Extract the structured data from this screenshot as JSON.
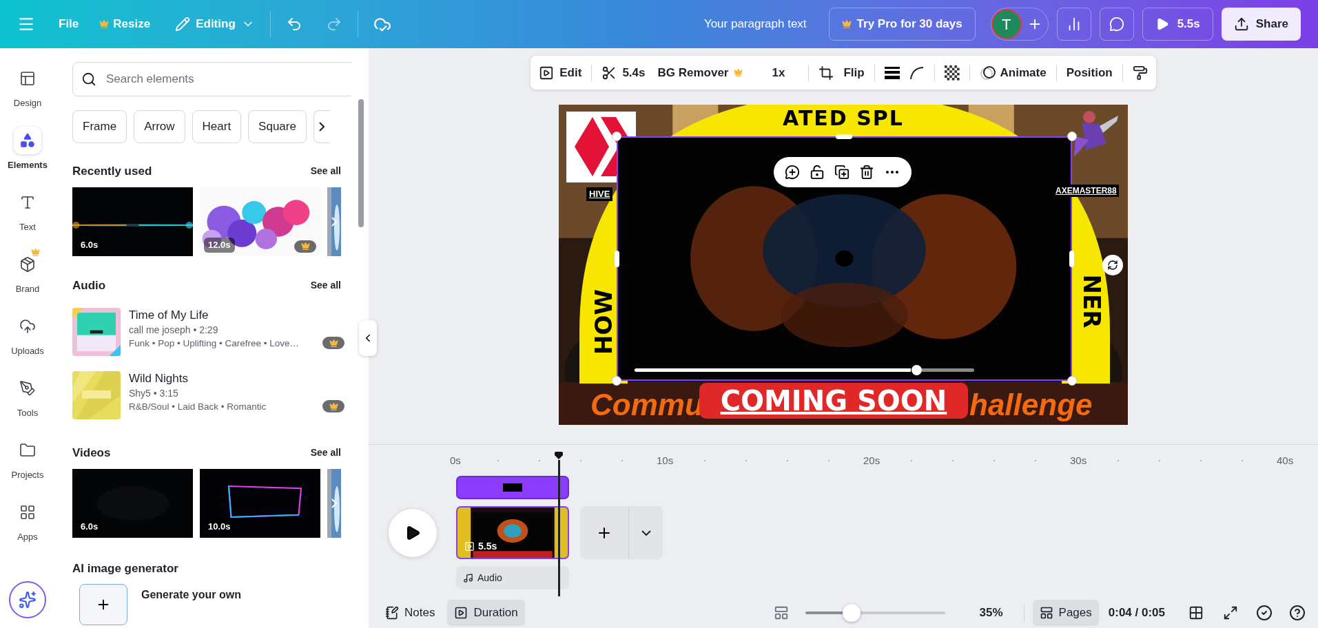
{
  "top_bar": {
    "file": "File",
    "resize": "Resize",
    "mode": "Editing",
    "doc_title": "Your paragraph text",
    "pro": "Try Pro for 30 days",
    "avatar": "T",
    "play": "5.5s",
    "share": "Share"
  },
  "rail": [
    {
      "label": "Design",
      "selected": false
    },
    {
      "label": "Elements",
      "selected": true
    },
    {
      "label": "Text",
      "selected": false
    },
    {
      "label": "Brand",
      "selected": false,
      "pro": true
    },
    {
      "label": "Uploads",
      "selected": false
    },
    {
      "label": "Tools",
      "selected": false
    },
    {
      "label": "Projects",
      "selected": false
    },
    {
      "label": "Apps",
      "selected": false
    }
  ],
  "panel": {
    "search": {
      "placeholder": "Search elements"
    },
    "chips": [
      "Frame",
      "Arrow",
      "Heart",
      "Square"
    ],
    "recent": {
      "title": "Recently used",
      "see_all": "See all",
      "items": [
        {
          "duration": "6.0s",
          "pro": false
        },
        {
          "duration": "12.0s",
          "pro": true
        }
      ]
    },
    "audio": {
      "title": "Audio",
      "see_all": "See all",
      "tracks": [
        {
          "title": "Time of My Life",
          "meta": "call me joseph • 2:29",
          "tags": "Funk • Pop • Uplifting • Carefree • Love…",
          "pro": true
        },
        {
          "title": "Wild Nights",
          "meta": "Shy5 • 3:15",
          "tags": "R&B/Soul • Laid Back • Romantic",
          "pro": true
        }
      ]
    },
    "videos": {
      "title": "Videos",
      "see_all": "See all",
      "items": [
        {
          "duration": "6.0s"
        },
        {
          "duration": "10.0s"
        }
      ]
    },
    "ai": {
      "title": "AI image generator",
      "action": "Generate your own"
    }
  },
  "toolbar": {
    "edit": "Edit",
    "trim": "5.4s",
    "bg_remover": "BG Remover",
    "speed": "1x",
    "flip": "Flip",
    "animate": "Animate",
    "position": "Position"
  },
  "design": {
    "arc_top": "ATED SPL",
    "arc_left": "HOW",
    "arc_right": "NER",
    "hive": "HIVE",
    "user": "AXEMASTER88",
    "coming": "COMING SOON",
    "left_text": "Commu",
    "right_text": "hallenge",
    "scrub": {
      "level": 0.83
    }
  },
  "timeline": {
    "ticks": [
      "0s",
      "10s",
      "20s",
      "30s",
      "40s"
    ],
    "clip_duration": "5.5s",
    "audio": "Audio"
  },
  "bottom_bar": {
    "notes": "Notes",
    "duration": {
      "label": "Duration",
      "selected": true
    },
    "zoom": {
      "level": 0.33
    },
    "zoom_text": "35%",
    "pages": {
      "label": "Pages",
      "selected": true
    },
    "time": "0:04 / 0:05"
  }
}
